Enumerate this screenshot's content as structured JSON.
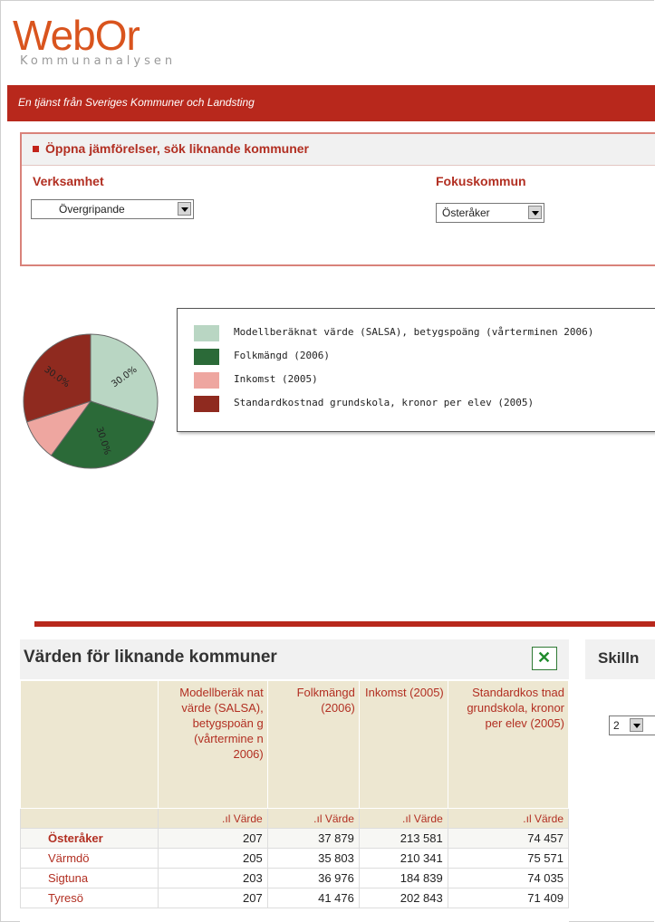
{
  "brand": {
    "name": "WebOr",
    "subtitle": "Kommunanalysen",
    "tagline": "En tjänst från Sveriges Kommuner och Landsting"
  },
  "search_panel": {
    "title": "Öppna jämförelser, sök liknande kommuner",
    "verksamhet_label": "Verksamhet",
    "verksamhet_value": "Övergripande",
    "fokus_label": "Fokuskommun",
    "fokus_value": "Österåker"
  },
  "chart_data": {
    "type": "pie",
    "slices": [
      {
        "label": "Modellberäknat värde (SALSA), betygspoäng (vårterminen 2006)",
        "value": 30.0,
        "color": "#b9d6c3",
        "shown_label": "30.0%"
      },
      {
        "label": "Folkmängd (2006)",
        "value": 30.0,
        "color": "#2b6a38",
        "shown_label": "30.0%"
      },
      {
        "label": "Inkomst (2005)",
        "value": 10.0,
        "color": "#eea6a0",
        "shown_label": ""
      },
      {
        "label": "Standardkostnad grundskola, kronor per elev (2005)",
        "value": 30.0,
        "color": "#8f2a1f",
        "shown_label": "30.0%"
      }
    ],
    "legend_position": "right"
  },
  "table_panel": {
    "title": "Värden för liknande kommuner",
    "excel_icon": "excel-icon",
    "columns": [
      "",
      "Modellberäk nat värde (SALSA), betygspoän g (vårtermine n 2006)",
      "Folkmängd (2006)",
      "Inkomst (2005)",
      "Standardkos tnad grundskola, kronor per elev (2005)"
    ],
    "sub_header": [
      "",
      ".ıl Värde",
      ".ıl Värde",
      ".ıl Värde",
      ".ıl Värde"
    ],
    "rows": [
      {
        "name": "Österåker",
        "values": [
          "207",
          "37 879",
          "213 581",
          "74 457"
        ]
      },
      {
        "name": "Värmdö",
        "values": [
          "205",
          "35 803",
          "210 341",
          "75 571"
        ]
      },
      {
        "name": "Sigtuna",
        "values": [
          "203",
          "36 976",
          "184 839",
          "74 035"
        ]
      },
      {
        "name": "Tyresö",
        "values": [
          "207",
          "41 476",
          "202 843",
          "71 409"
        ]
      }
    ]
  },
  "side_panel": {
    "title": "Skilln",
    "select_value": "2"
  }
}
